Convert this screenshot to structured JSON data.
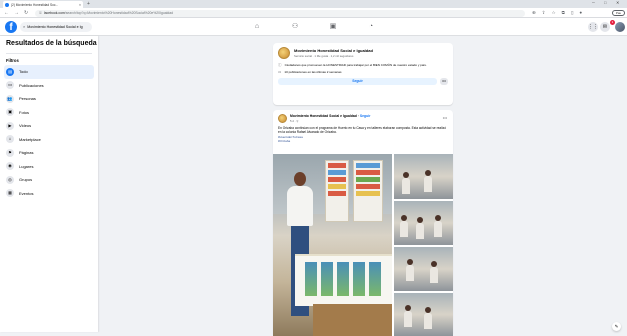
{
  "browser": {
    "tab_title": "(2) Movimiento Honestidad Soc...",
    "tab_close": "×",
    "new_tab": "+",
    "url_host": "facebook.com",
    "url_path": "/search/top?q=Movimiento%20Honestidad%20Social%20e%20Igualdad",
    "profile_label": "Pau"
  },
  "fb": {
    "logo": "f",
    "search_value": "Movimiento Honestidad Social e Ig",
    "nav_icons": [
      "home-icon",
      "friends-icon",
      "watch-icon",
      "gaming-icon"
    ],
    "notif_count": "1"
  },
  "sidebar": {
    "title": "Resultados de la búsqueda",
    "filters_label": "Filtros",
    "items": [
      {
        "label": "Todo",
        "icon": "▤",
        "active": true
      },
      {
        "label": "Publicaciones",
        "icon": "▭"
      },
      {
        "label": "Personas",
        "icon": "👥"
      },
      {
        "label": "Fotos",
        "icon": "▣"
      },
      {
        "label": "Videos",
        "icon": "▶"
      },
      {
        "label": "Marketplace",
        "icon": "⌂"
      },
      {
        "label": "Páginas",
        "icon": "⚑"
      },
      {
        "label": "Lugares",
        "icon": "◉"
      },
      {
        "label": "Grupos",
        "icon": "◎"
      },
      {
        "label": "Eventos",
        "icon": "▦"
      }
    ]
  },
  "page_card": {
    "name": "Movimiento Honestidad Social e Igualdad",
    "meta": "Servicio social · 1 Me gusta · 1,2 mil seguidores",
    "info": "Ciudadanos que promueven la HONESTIDAD para trabajar por el BIEN COMÚN de nuestro estado y país.",
    "posts_info": "10 publicaciones en las últimas 2 semanas",
    "follow_label": "Seguir",
    "more_label": "•••"
  },
  "post": {
    "page_name": "Movimiento Honestidad Social e Igualdad",
    "follow_link": "Seguir",
    "date": "5 d · ⚲",
    "dots": "•••",
    "text": "En Orizaba continúan con el programa de Huerto en tu Casa y en talleres elaboran composta. Esta actividad se realizó en la colonia Rafael Alvarado de Orizaba.",
    "hashtags": [
      "#HuertoEnTuCasa",
      "#Orizaba"
    ]
  },
  "corner_button": "✎"
}
